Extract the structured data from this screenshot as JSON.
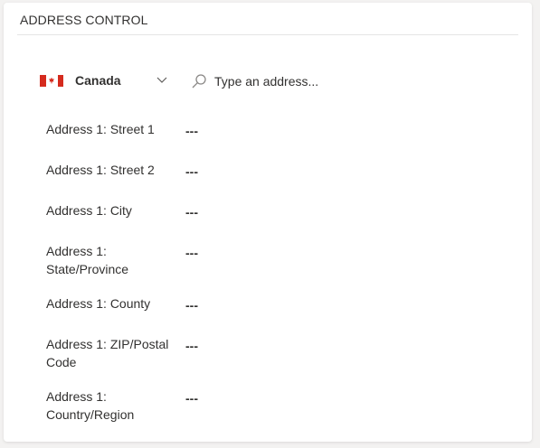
{
  "section": {
    "title": "ADDRESS CONTROL"
  },
  "country": {
    "name": "Canada",
    "flag_icon": "canada-flag-icon",
    "chevron_icon": "chevron-down-icon"
  },
  "search": {
    "placeholder": "Type an address...",
    "value": "",
    "icon": "search-icon"
  },
  "fields": [
    {
      "label": "Address 1: Street 1",
      "value": "---"
    },
    {
      "label": "Address 1: Street 2",
      "value": "---"
    },
    {
      "label": "Address 1: City",
      "value": "---"
    },
    {
      "label": "Address 1: State/Province",
      "value": "---"
    },
    {
      "label": "Address 1: County",
      "value": "---"
    },
    {
      "label": "Address 1: ZIP/Postal Code",
      "value": "---"
    },
    {
      "label": "Address 1: Country/Region",
      "value": "---"
    }
  ],
  "colors": {
    "flag_red": "#d52b1e",
    "text": "#323130",
    "search_icon": "#8a8886"
  }
}
